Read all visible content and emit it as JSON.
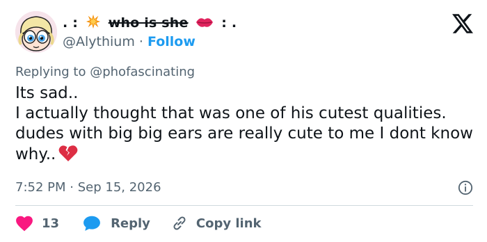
{
  "author": {
    "name_prefix": ". :",
    "name_main": "who is she",
    "name_suffix": ": .",
    "handle": "@Alythium",
    "separator": "·",
    "follow_label": "Follow",
    "avatar_icon": "cartoon-character-avatar"
  },
  "reply_context": {
    "label": "Replying to",
    "mention": "@phofascinating"
  },
  "tweet": {
    "lines": [
      "Its sad..",
      "I actually thought that was one of his cutest qualities. dudes with big big ears are really cute to me I dont know why.."
    ],
    "emoji": "broken-heart-icon"
  },
  "meta": {
    "time": "7:52 PM",
    "separator": "·",
    "date": "Sep 15, 2026"
  },
  "actions": {
    "like_count": "13",
    "reply_label": "Reply",
    "copy_label": "Copy link"
  },
  "colors": {
    "accent": "#1d9bf0",
    "like": "#f91880",
    "muted": "#536471",
    "text": "#0f1419"
  }
}
